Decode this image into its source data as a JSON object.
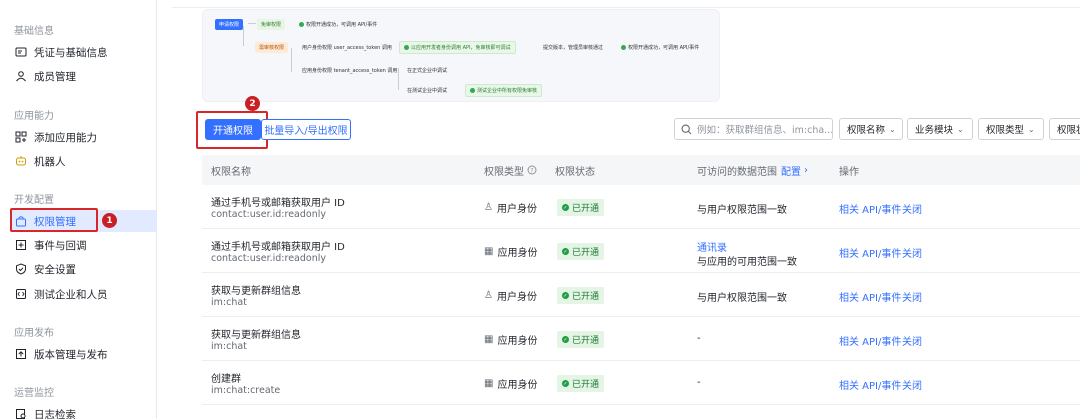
{
  "sidebar": {
    "groups": {
      "basic": "基础信息",
      "capability": "应用能力",
      "dev": "开发配置",
      "publish": "应用发布",
      "ops": "运营监控"
    },
    "items": [
      {
        "label": "凭证与基础信息",
        "icon": "credential-icon"
      },
      {
        "label": "成员管理",
        "icon": "user-icon"
      },
      {
        "label": "添加应用能力",
        "icon": "apps-add-icon"
      },
      {
        "label": "机器人",
        "icon": "robot-icon"
      },
      {
        "label": "权限管理",
        "icon": "permission-icon"
      },
      {
        "label": "事件与回调",
        "icon": "event-icon"
      },
      {
        "label": "安全设置",
        "icon": "shield-icon"
      },
      {
        "label": "测试企业和人员",
        "icon": "test-icon"
      },
      {
        "label": "版本管理与发布",
        "icon": "upload-icon"
      },
      {
        "label": "日志检索",
        "icon": "log-icon"
      }
    ],
    "badge_1": "1"
  },
  "flow": {
    "start": "申请权限",
    "free": "免审权限",
    "free_result": "权限开通成功，可调用 API/事件",
    "review": "需审核权限",
    "user_identity": "用户身份权限 user_access_token 调用",
    "test_scope": "以应用开发者身份调用 API，免审核即可调试",
    "submit": "提交版本，管理员审核通过",
    "review_result": "权限开通成功，可调用 API/事件",
    "app_identity": "应用身份权限 tenant_access_token 调用",
    "formal_debug": "在正式企业中调试",
    "test_debug": "在测试企业中调试",
    "test_all": "测试企业中所有权限免审核"
  },
  "toolbar": {
    "open_label": "开通权限",
    "badge_2": "2",
    "batch_label": "批量导入/导出权限",
    "search_placeholder": "例如：获取群组信息、im:cha...",
    "filters": [
      "权限名称",
      "业务模块",
      "权限类型",
      "权限状态"
    ]
  },
  "table": {
    "headers": {
      "name": "权限名称",
      "type": "权限类型",
      "status": "权限状态",
      "scope": "可访问的数据范围",
      "scope_link": "配置",
      "actions": "操作"
    },
    "rows": [
      {
        "name": "通过手机号或邮箱获取用户 ID",
        "code": "contact:user.id:readonly",
        "type": "用户身份",
        "type_icon": "user-icon",
        "status": "已开通",
        "scope_link": "",
        "scope": "与用户权限范围一致",
        "api": "相关 API/事件",
        "close": "关闭"
      },
      {
        "name": "通过手机号或邮箱获取用户 ID",
        "code": "contact:user.id:readonly",
        "type": "应用身份",
        "type_icon": "app-icon",
        "status": "已开通",
        "scope_link": "通讯录",
        "scope": "与应用的可用范围一致",
        "api": "相关 API/事件",
        "close": "关闭"
      },
      {
        "name": "获取与更新群组信息",
        "code": "im:chat",
        "type": "用户身份",
        "type_icon": "user-icon",
        "status": "已开通",
        "scope_link": "",
        "scope": "与用户权限范围一致",
        "api": "相关 API/事件",
        "close": "关闭"
      },
      {
        "name": "获取与更新群组信息",
        "code": "im:chat",
        "type": "应用身份",
        "type_icon": "app-icon",
        "status": "已开通",
        "scope_link": "",
        "scope": "-",
        "api": "相关 API/事件",
        "close": "关闭"
      },
      {
        "name": "创建群",
        "code": "im:chat:create",
        "type": "应用身份",
        "type_icon": "app-icon",
        "status": "已开通",
        "scope_link": "",
        "scope": "-",
        "api": "相关 API/事件",
        "close": "关闭"
      }
    ]
  }
}
